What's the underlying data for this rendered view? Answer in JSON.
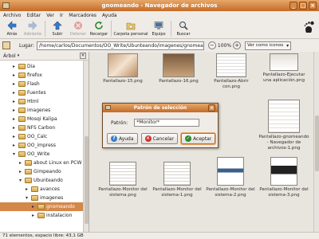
{
  "window": {
    "title": "gnomeando - Navegador de archivos"
  },
  "menu": [
    "Archivo",
    "Editar",
    "Ver",
    "Ir",
    "Marcadores",
    "Ayuda"
  ],
  "toolbar": {
    "back": "Atrás",
    "forward": "Adelante",
    "up": "Subir",
    "stop": "Detener",
    "reload": "Recargar",
    "home": "Carpeta personal",
    "computer": "Equipo",
    "search": "Buscar"
  },
  "location": {
    "label": "Lugar:",
    "path": "/home/carlos/Documentos/OO_Write/Ubunteando/imagenes/gnomeando",
    "zoom": "100%",
    "view": "Ver como iconos"
  },
  "side": {
    "header": "Árbol",
    "items": [
      {
        "label": "Dia",
        "exp": "▸"
      },
      {
        "label": "firefox",
        "exp": "▸"
      },
      {
        "label": "Flash",
        "exp": "▸"
      },
      {
        "label": "Fuentes",
        "exp": "▸"
      },
      {
        "label": "Html",
        "exp": "▸"
      },
      {
        "label": "imagenes",
        "exp": "▸"
      },
      {
        "label": "Mosqi Kalipa",
        "exp": "▸"
      },
      {
        "label": "NFS Carbon",
        "exp": "▸"
      },
      {
        "label": "OO_Calc",
        "exp": "▸"
      },
      {
        "label": "OO_impress",
        "exp": "▸"
      },
      {
        "label": "OO_Write",
        "exp": "▾"
      },
      {
        "label": "about Linux en PCW",
        "exp": "▸"
      },
      {
        "label": "Gimpeando",
        "exp": "▸"
      },
      {
        "label": "Ubunteando",
        "exp": "▾"
      },
      {
        "label": "avances",
        "exp": "▸"
      },
      {
        "label": "imagenes",
        "exp": "▾"
      },
      {
        "label": "gnomeando",
        "exp": "▸"
      },
      {
        "label": "instalacion",
        "exp": "▸"
      }
    ]
  },
  "files": [
    {
      "name": "Pantallazo-15.png"
    },
    {
      "name": "Pantallazo-16.png"
    },
    {
      "name": "Pantallazo-Abrir con.png"
    },
    {
      "name": "Pantallazo-Ejecutar una aplicación.png"
    },
    {
      "name": "Pantallazo-gnomeando - Navegador de archivos-1.png"
    },
    {
      "name": "Pantallazo-Monitor del sistema.png"
    },
    {
      "name": "Pantallazo-Monitor del sistema-1.png"
    },
    {
      "name": "Pantallazo-Monitor del sistema-2.png"
    },
    {
      "name": "Pantallazo-Monitor del sistema-3.png"
    }
  ],
  "status": "71 elementos, espacio libre: 43,1 GB",
  "dialog": {
    "title": "Patrón de selección",
    "pattern_label": "Patrón:",
    "pattern_value": "*Monitor*",
    "help": "Ayuda",
    "cancel": "Cancelar",
    "accept": "Aceptar"
  }
}
